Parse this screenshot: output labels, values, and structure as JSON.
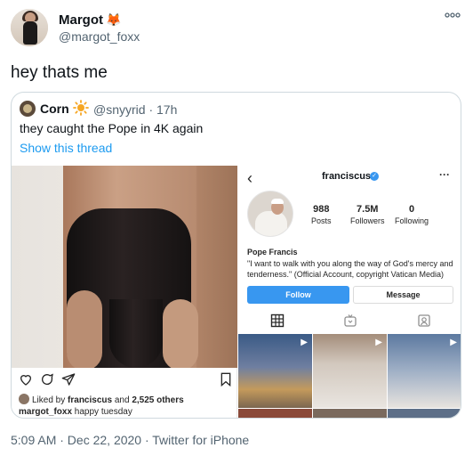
{
  "tweet": {
    "display_name": "Margot",
    "name_emoji": "🦊",
    "username": "@margot_foxx",
    "text": "hey thats me",
    "more_icon": "more-horizontal-icon",
    "timestamp": "5:09 AM · Dec 22, 2020 · Twitter for iPhone"
  },
  "quote": {
    "display_name": "Corn",
    "name_emoji_icon": "sun-icon",
    "meta": "@snyyrid · 17h",
    "text": "they caught the Pope in 4K again",
    "show_thread": "Show this thread"
  },
  "left_post": {
    "liked_prefix": "Liked by ",
    "liked_user": "franciscus",
    "liked_middle": " and ",
    "liked_count": "2,525 others",
    "caption_user": "margot_foxx",
    "caption_text": " happy tuesday"
  },
  "ig_profile": {
    "handle": "franciscus",
    "posts_num": "988",
    "posts_label": "Posts",
    "followers_num": "7.5M",
    "followers_label": "Followers",
    "following_num": "0",
    "following_label": "Following",
    "bio_name": "Pope Francis",
    "bio_text": "\"I want to walk with you along the way of God's mercy and tenderness.\" (Official Account, copyright Vatican Media)",
    "follow_label": "Follow",
    "message_label": "Message"
  },
  "colors": {
    "accent": "#1d9bf0",
    "ig_blue": "#3897f0",
    "secondary_text": "#536471",
    "border": "#cfd9de"
  }
}
